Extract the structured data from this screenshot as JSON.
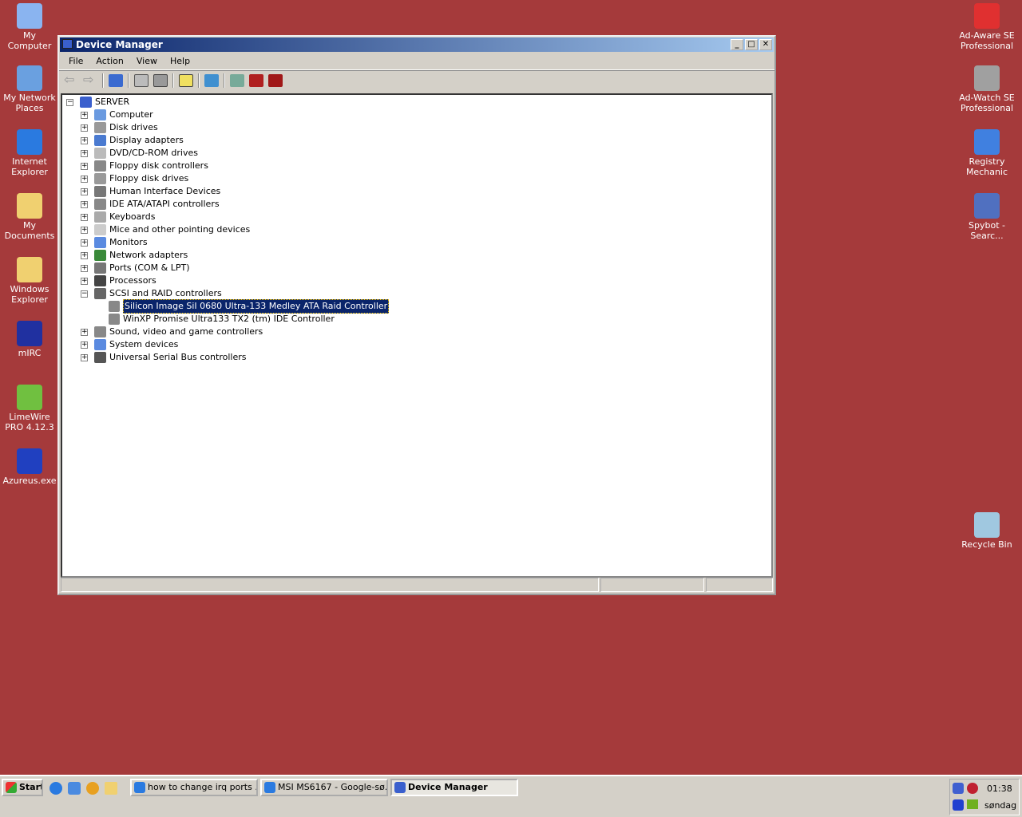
{
  "desktop_left": [
    {
      "label": "My Computer",
      "color": "#8ab4f0"
    },
    {
      "label": "My Network Places",
      "color": "#6aa0e0"
    },
    {
      "label": "Internet Explorer",
      "color": "#2a7ae0"
    },
    {
      "label": "My Documents",
      "color": "#f0d070"
    },
    {
      "label": "Windows Explorer",
      "color": "#f0d070"
    },
    {
      "label": "mIRC",
      "color": "#2030a0"
    },
    {
      "label": "LimeWire PRO 4.12.3",
      "color": "#70c040"
    },
    {
      "label": "Azureus.exe",
      "color": "#2040c0"
    }
  ],
  "desktop_right": [
    {
      "label": "Ad-Aware SE Professional",
      "color": "#e03030"
    },
    {
      "label": "Ad-Watch SE Professional",
      "color": "#a0a0a0"
    },
    {
      "label": "Registry Mechanic",
      "color": "#4080e0"
    },
    {
      "label": "Spybot - Searc...",
      "color": "#5070c0"
    },
    {
      "label": "Recycle Bin",
      "color": "#a0c8e0"
    }
  ],
  "window": {
    "title": "Device Manager",
    "menu": [
      "File",
      "Action",
      "View",
      "Help"
    ]
  },
  "tree": {
    "root": "SERVER",
    "items": [
      {
        "label": "Computer",
        "expanded": false
      },
      {
        "label": "Disk drives",
        "expanded": false
      },
      {
        "label": "Display adapters",
        "expanded": false
      },
      {
        "label": "DVD/CD-ROM drives",
        "expanded": false
      },
      {
        "label": "Floppy disk controllers",
        "expanded": false
      },
      {
        "label": "Floppy disk drives",
        "expanded": false
      },
      {
        "label": "Human Interface Devices",
        "expanded": false
      },
      {
        "label": "IDE ATA/ATAPI controllers",
        "expanded": false
      },
      {
        "label": "Keyboards",
        "expanded": false
      },
      {
        "label": "Mice and other pointing devices",
        "expanded": false
      },
      {
        "label": "Monitors",
        "expanded": false
      },
      {
        "label": "Network adapters",
        "expanded": false
      },
      {
        "label": "Ports (COM & LPT)",
        "expanded": false
      },
      {
        "label": "Processors",
        "expanded": false
      },
      {
        "label": "SCSI and RAID controllers",
        "expanded": true,
        "children": [
          "Silicon Image SiI 0680 Ultra-133 Medley ATA Raid Controller",
          "WinXP Promise Ultra133 TX2 (tm) IDE Controller"
        ]
      },
      {
        "label": "Sound, video and game controllers",
        "expanded": false
      },
      {
        "label": "System devices",
        "expanded": false
      },
      {
        "label": "Universal Serial Bus controllers",
        "expanded": false
      }
    ],
    "selected": "Silicon Image SiI 0680 Ultra-133 Medley ATA Raid Controller"
  },
  "taskbar": {
    "start": "Start",
    "tasks": [
      "how to change irq ports ...",
      "MSI MS6167 - Google-sø...",
      "Device Manager"
    ],
    "active_task": "Device Manager",
    "time": "01:38",
    "day": "søndag"
  }
}
